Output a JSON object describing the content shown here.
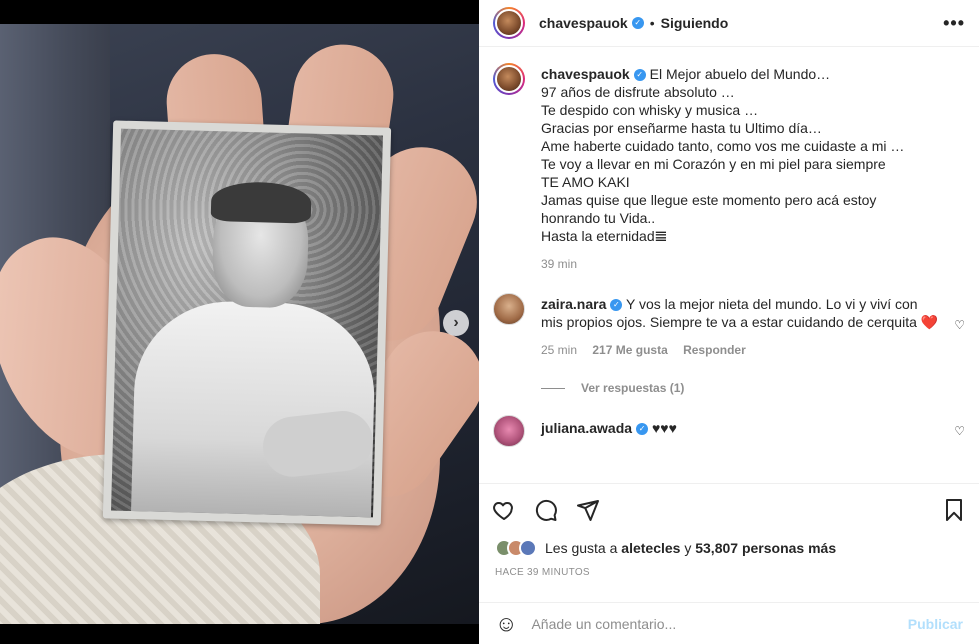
{
  "header": {
    "username": "chavespauok",
    "separator": "•",
    "follow_status": "Siguiendo",
    "more": "•••"
  },
  "caption": {
    "username": "chavespauok",
    "lines": [
      "El Mejor abuelo del Mundo…",
      "97 años de disfrute absoluto …",
      "Te despido con whisky y musica …",
      "Gracias por enseñarme hasta tu Ultimo día…",
      "Ame haberte cuidado tanto, como vos me cuidaste a mi …",
      "Te voy a llevar en mi Corazón y en mi piel para siempre",
      "TE AMO KAKI",
      "Jamas quise que llegue este momento pero acá estoy",
      "honrando tu Vida..",
      "Hasta la eternidad𝌆"
    ],
    "time": "39 min"
  },
  "comments": [
    {
      "username": "zaira.nara",
      "text": "Y vos la mejor nieta del mundo. Lo vi y viví con mis propios ojos. Siempre te va a estar cuidando de cerquita ❤️",
      "time": "25 min",
      "likes": "217 Me gusta",
      "reply": "Responder",
      "view_replies": "Ver respuestas (1)"
    },
    {
      "username": "juliana.awada",
      "text": "♥♥♥"
    }
  ],
  "likes_bar": {
    "prefix": "Les gusta a",
    "user": "aletecles",
    "connector": "y",
    "count": "53,807 personas más"
  },
  "timestamp": "HACE 39 MINUTOS",
  "comment_box": {
    "placeholder": "Añade un comentario...",
    "publish": "Publicar"
  },
  "media": {
    "next": "›"
  },
  "colors": {
    "verified": "#3897f0",
    "publish_disabled": "#b2dffc",
    "meta_gray": "#8e8e8e"
  }
}
